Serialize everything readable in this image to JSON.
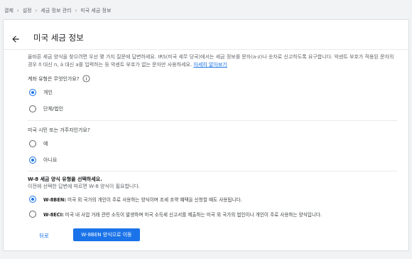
{
  "breadcrumb": {
    "items": [
      "결제",
      "설정",
      "세금 정보 관리",
      "미국 세금 정보"
    ],
    "separator": "›"
  },
  "page": {
    "title": "미국 세금 정보",
    "intro": "올바른 세금 양식을 찾으려면 우선 몇 가지 질문에 답변하세요. IRS(미국 세무 당국)에서는 세금 정보를 문자(a-z)나 숫자로 신고하도록 요구합니다. 악센트 부호가 적용된 문자의 경우 ñ 대신 n, á 대신 a를 입력하는 등 악센트 부호가 없는 문자만 사용하세요.",
    "learn_more": "자세히 알아보기"
  },
  "account_type": {
    "question": "계좌 유형은 무엇인가요?",
    "options": [
      {
        "label": "개인",
        "selected": true
      },
      {
        "label": "단체/법인",
        "selected": false
      }
    ]
  },
  "us_person": {
    "question": "미국 시민 또는 거주자인가요?",
    "options": [
      {
        "label": "예",
        "selected": false
      },
      {
        "label": "아니요",
        "selected": true
      }
    ]
  },
  "w8": {
    "heading": "W-8 세금 양식 유형을 선택하세요.",
    "subheading": "이전에 선택한 답변에 따르면 W-8 양식이 필요합니다.",
    "options": [
      {
        "code": "W-8BEN:",
        "description": "미국 외 국가의 개인이 주로 사용하는 양식이며 조세 조약 혜택을 신청할 때도 사용됩니다.",
        "selected": true
      },
      {
        "code": "W-8ECI:",
        "description": "미국 내 사업 거래 관련 소득이 발생하며 미국 소득세 신고서를 제출하는 미국 외 국가의 법인이나 개인이 주로 사용하는 양식입니다.",
        "selected": false
      }
    ]
  },
  "actions": {
    "back": "뒤로",
    "continue": "W-8BEN 양식으로 이동"
  },
  "colors": {
    "accent": "#1a73e8",
    "text": "#3c4043",
    "muted": "#5f6368",
    "background": "#f1f3f4"
  }
}
